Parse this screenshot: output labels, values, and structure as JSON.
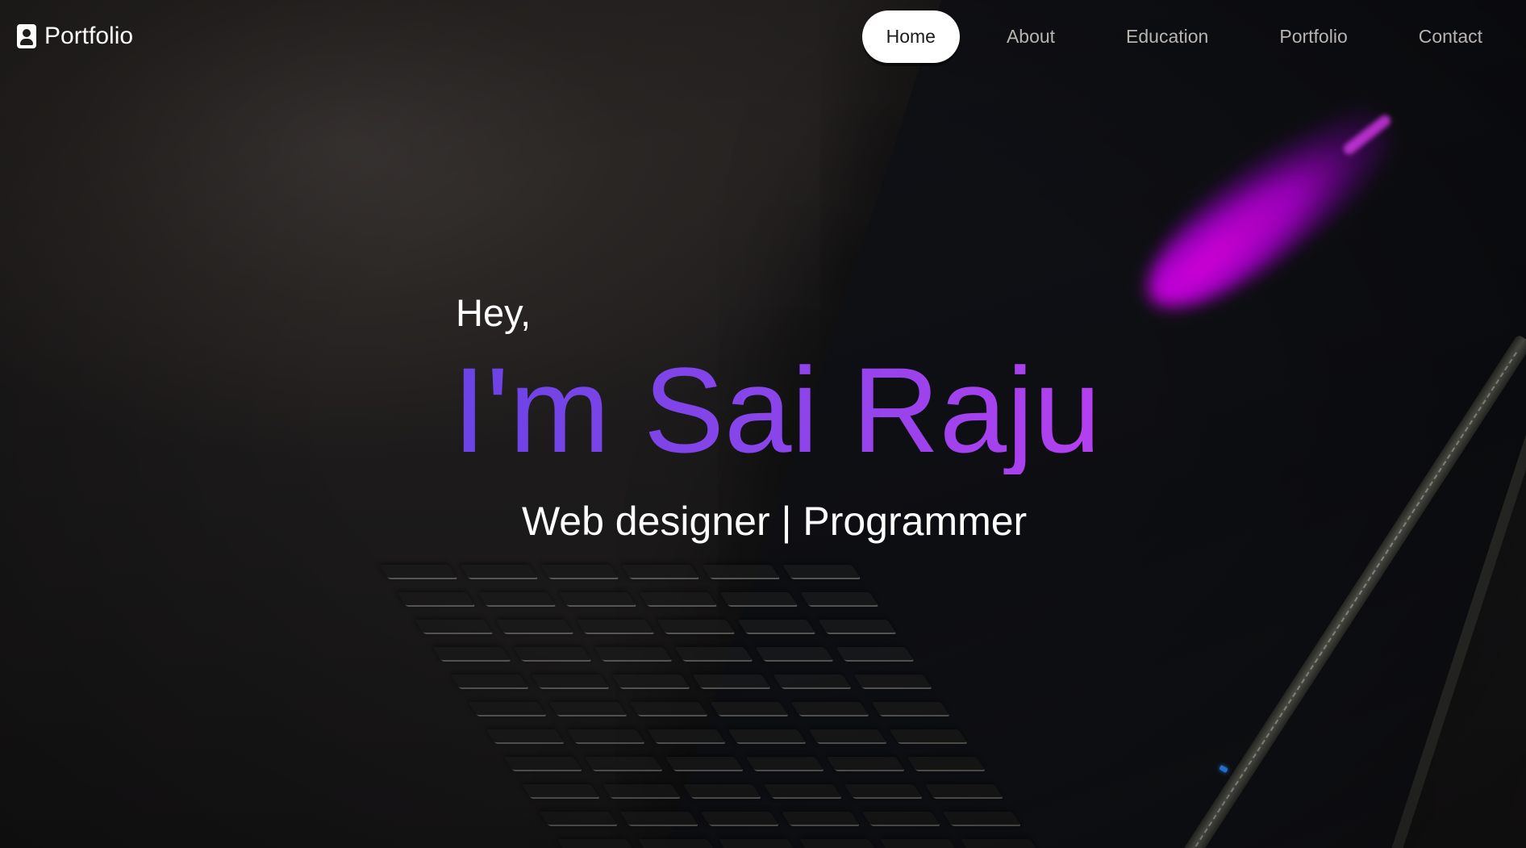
{
  "nav": {
    "brand_label": "Portfolio",
    "brand_icon": "contact-card-icon",
    "links": [
      {
        "label": "Home",
        "active": true
      },
      {
        "label": "About",
        "active": false
      },
      {
        "label": "Education",
        "active": false
      },
      {
        "label": "Portfolio",
        "active": false
      },
      {
        "label": "Contact",
        "active": false
      }
    ]
  },
  "hero": {
    "greeting": "Hey,",
    "name": "I'm Sai Raju",
    "tagline": "Web designer | Programmer",
    "name_gradient": [
      "#6a43e6",
      "#b43ff0"
    ]
  },
  "colors": {
    "background": "#1d1b1b",
    "nav_text": "#b8b4b0",
    "active_pill": "#ffffff",
    "accent_glow": "#e400e8"
  }
}
